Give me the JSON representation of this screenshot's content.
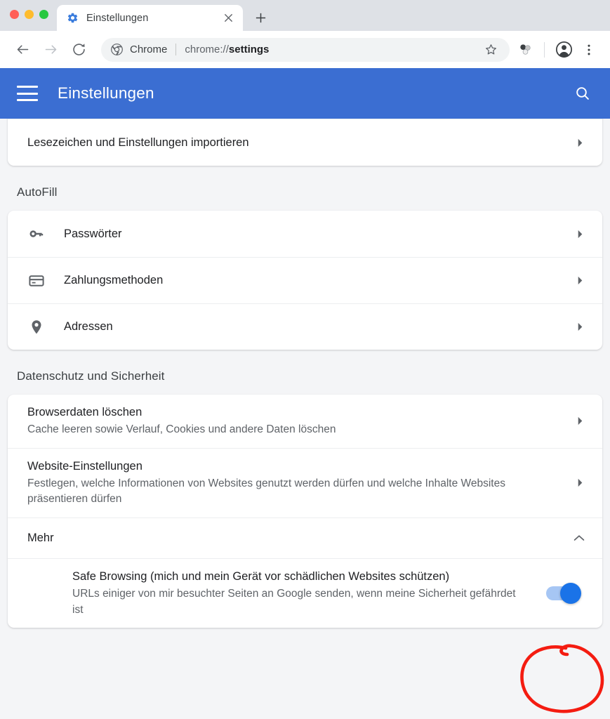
{
  "window": {
    "traffic_lights": [
      "close",
      "minimize",
      "maximize"
    ],
    "colors": {
      "close": "#ff5f57",
      "minimize": "#febc2e",
      "maximize": "#28c840",
      "tabstrip_bg": "#dee1e6",
      "app_header_blue": "#3b6ed2",
      "toggle_on": "#1a73e8",
      "toggle_track": "#a6c6f4",
      "annotation_red": "#f41c11",
      "page_bg": "#f4f5f7"
    }
  },
  "tab": {
    "title": "Einstellungen",
    "favicon": "gear-icon",
    "close_label": "×",
    "new_tab_label": "+"
  },
  "toolbar": {
    "back_label": "←",
    "forward_label": "→",
    "reload_label": "⟳",
    "chrome_label": "Chrome",
    "url_scheme": "chrome://",
    "url_path": "settings",
    "url_full": "chrome://settings",
    "star_icon": "star-icon",
    "extensions_icon": "molecule-icon",
    "profile_icon": "account-avatar-icon",
    "menu_icon": "three-dot-menu-icon"
  },
  "app_header": {
    "menu_icon": "hamburger-icon",
    "title": "Einstellungen",
    "search_icon": "search-icon"
  },
  "content": {
    "clipped_card": {
      "rows": [
        {
          "title": "Lesezeichen und Einstellungen importieren",
          "icon": null,
          "chevron": "right"
        }
      ]
    },
    "autofill": {
      "heading": "AutoFill",
      "rows": [
        {
          "title": "Passwörter",
          "icon": "key-icon",
          "chevron": "right"
        },
        {
          "title": "Zahlungsmethoden",
          "icon": "credit-card-icon",
          "chevron": "right"
        },
        {
          "title": "Adressen",
          "icon": "location-pin-icon",
          "chevron": "right"
        }
      ]
    },
    "privacy": {
      "heading": "Datenschutz und Sicherheit",
      "rows": [
        {
          "title": "Browserdaten löschen",
          "sub": "Cache leeren sowie Verlauf, Cookies und andere Daten löschen",
          "chevron": "right"
        },
        {
          "title": "Website-Einstellungen",
          "sub": "Festlegen, welche Informationen von Websites genutzt werden dürfen und welche Inhalte Websites präsentieren dürfen",
          "chevron": "right"
        },
        {
          "title": "Mehr",
          "sub": "",
          "chevron": "up"
        }
      ],
      "safe_browsing": {
        "title": "Safe Browsing (mich und mein Gerät vor schädlichen Websites schützen)",
        "sub": "URLs einiger von mir besuchter Seiten an Google senden, wenn meine Sicherheit gefährdet ist",
        "toggle_state": "on"
      }
    }
  },
  "annotation": {
    "shape": "hand-drawn-red-circle",
    "target": "safe-browsing-toggle",
    "color": "#f41c11"
  }
}
